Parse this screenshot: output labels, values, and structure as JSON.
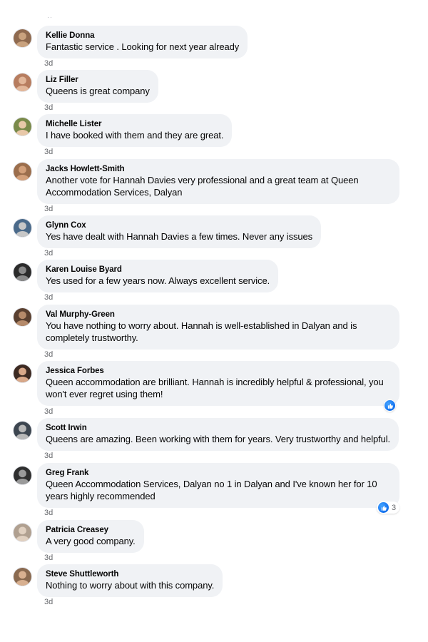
{
  "comments": [
    {
      "author": "Kellie Donna",
      "text": "Fantastic service . Looking for next year already",
      "time": "3d",
      "avatar_color": "#c9a27e",
      "avatar_bg": "#8f6a4f"
    },
    {
      "author": "Liz Filler",
      "text": "Queens is great company",
      "time": "3d",
      "avatar_color": "#e2b79a",
      "avatar_bg": "#b77d5f"
    },
    {
      "author": "Michelle Lister",
      "text": "I have booked with them and they are great.",
      "time": "3d",
      "avatar_color": "#e8c8a8",
      "avatar_bg": "#7a8a4a"
    },
    {
      "author": "Jacks Howlett-Smith",
      "text": "Another vote for Hannah Davies very professional and a great team at Queen Accommodation Services, Dalyan",
      "time": "3d",
      "avatar_color": "#d3a07a",
      "avatar_bg": "#9b6e4c"
    },
    {
      "author": "Glynn Cox",
      "text": "Yes have dealt with Hannah Davies a few times. Never any issues",
      "time": "3d",
      "avatar_color": "#c7c7c7",
      "avatar_bg": "#4a6a8a"
    },
    {
      "author": "Karen Louise Byard",
      "text": "Yes used for a few years now. Always excellent service.",
      "time": "3d",
      "avatar_color": "#8a8a8a",
      "avatar_bg": "#2b2b2b"
    },
    {
      "author": "Val Murphy-Green",
      "text": "You have nothing to worry about. Hannah is well-established in Dalyan and is completely trustworthy.",
      "time": "3d",
      "avatar_color": "#b58a6a",
      "avatar_bg": "#5a4030"
    },
    {
      "author": "Jessica Forbes",
      "text": "Queen accommodation are brilliant. Hannah is incredibly helpful & professional, you won't ever regret using them!",
      "time": "3d",
      "avatar_color": "#d8a889",
      "avatar_bg": "#3d2a22",
      "reaction": {
        "icon": "like-icon",
        "count": ""
      }
    },
    {
      "author": "Scott Irwin",
      "text": "Queens are amazing. Been working with them for years. Very trustworthy and helpful.",
      "time": "3d",
      "avatar_color": "#b8b8b8",
      "avatar_bg": "#3d4650"
    },
    {
      "author": "Greg Frank",
      "text": "Queen Accommodation Services, Dalyan no 1 in Dalyan and I've known her for 10 years highly recommended",
      "time": "3d",
      "avatar_color": "#9a9a9a",
      "avatar_bg": "#2f2f2f",
      "reaction": {
        "icon": "like-icon",
        "count": "3"
      }
    },
    {
      "author": "Patricia Creasey",
      "text": "A very good company.",
      "time": "3d",
      "avatar_color": "#e0d0c0",
      "avatar_bg": "#b0a090"
    },
    {
      "author": "Steve Shuttleworth",
      "text": "Nothing to worry about with this company.",
      "time": "3d",
      "avatar_color": "#d8b090",
      "avatar_bg": "#8a6a50"
    }
  ],
  "colors": {
    "bubble": "#f0f2f5",
    "meta_text": "#65676b",
    "like_blue": "#1877f2"
  }
}
